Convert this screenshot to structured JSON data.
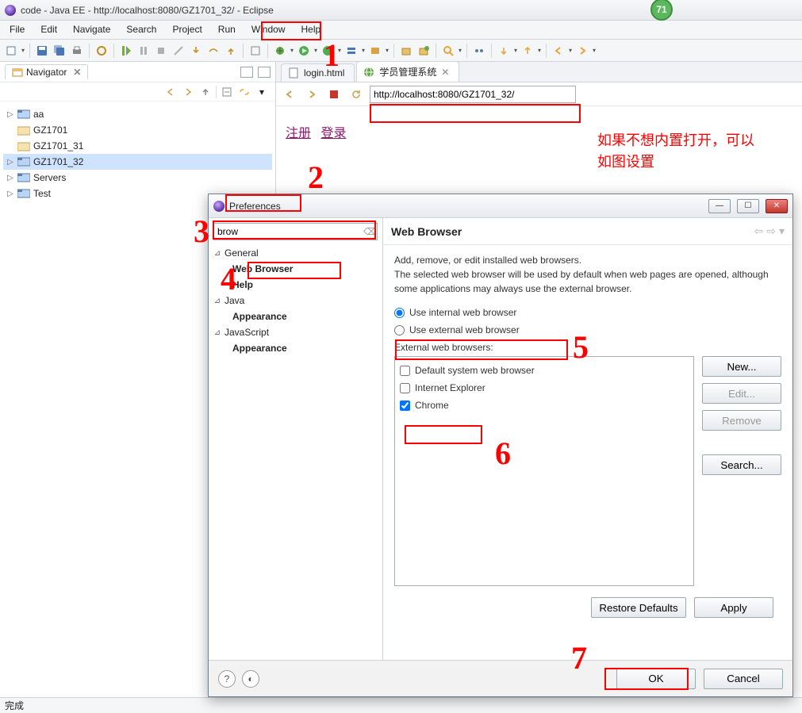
{
  "window": {
    "title": "code - Java EE - http://localhost:8080/GZ1701_32/ - Eclipse",
    "notification_count": "71"
  },
  "menu": [
    "File",
    "Edit",
    "Navigate",
    "Search",
    "Project",
    "Run",
    "Window",
    "Help"
  ],
  "statusbar": "完成",
  "navigator": {
    "title": "Navigator",
    "items": [
      {
        "label": "aa",
        "expandable": true,
        "icon": "project"
      },
      {
        "label": "GZ1701",
        "expandable": false,
        "icon": "folder"
      },
      {
        "label": "GZ1701_31",
        "expandable": false,
        "icon": "folder"
      },
      {
        "label": "GZ1701_32",
        "expandable": true,
        "icon": "project",
        "selected": true
      },
      {
        "label": "Servers",
        "expandable": true,
        "icon": "project"
      },
      {
        "label": "Test",
        "expandable": true,
        "icon": "project"
      }
    ]
  },
  "editor": {
    "tabs": [
      {
        "label": "login.html",
        "icon": "file"
      },
      {
        "label": "学员管理系统",
        "icon": "globe",
        "active": true
      }
    ],
    "url": "http://localhost:8080/GZ1701_32/",
    "page_links": [
      "注册",
      "登录"
    ]
  },
  "annotation_note": "如果不想内置打开，可以\n如图设置",
  "annotations": [
    "1",
    "2",
    "3",
    "4",
    "5",
    "6",
    "7"
  ],
  "prefs": {
    "title": "Preferences",
    "search_value": "brow",
    "tree": {
      "general": {
        "label": "General",
        "children": [
          {
            "label": "Web Browser",
            "selected": true
          },
          {
            "label": "Help"
          }
        ]
      },
      "java": {
        "label": "Java",
        "children": [
          {
            "label": "Appearance"
          }
        ]
      },
      "javascript": {
        "label": "JavaScript",
        "children": [
          {
            "label": "Appearance"
          }
        ]
      }
    },
    "page": {
      "heading": "Web Browser",
      "desc": "Add, remove, or edit installed web browsers.\nThe selected web browser will be used by default when web pages are opened, although some applications may always use the external browser.",
      "radio_internal": "Use internal web browser",
      "radio_external": "Use external web browser",
      "external_label": "External web browsers:",
      "browsers": [
        {
          "label": "Default system web browser",
          "checked": false
        },
        {
          "label": "Internet Explorer",
          "checked": false
        },
        {
          "label": "Chrome",
          "checked": true
        }
      ],
      "btn_new": "New...",
      "btn_edit": "Edit...",
      "btn_remove": "Remove",
      "btn_search": "Search...",
      "btn_restore": "Restore Defaults",
      "btn_apply": "Apply",
      "btn_ok": "OK",
      "btn_cancel": "Cancel"
    }
  }
}
